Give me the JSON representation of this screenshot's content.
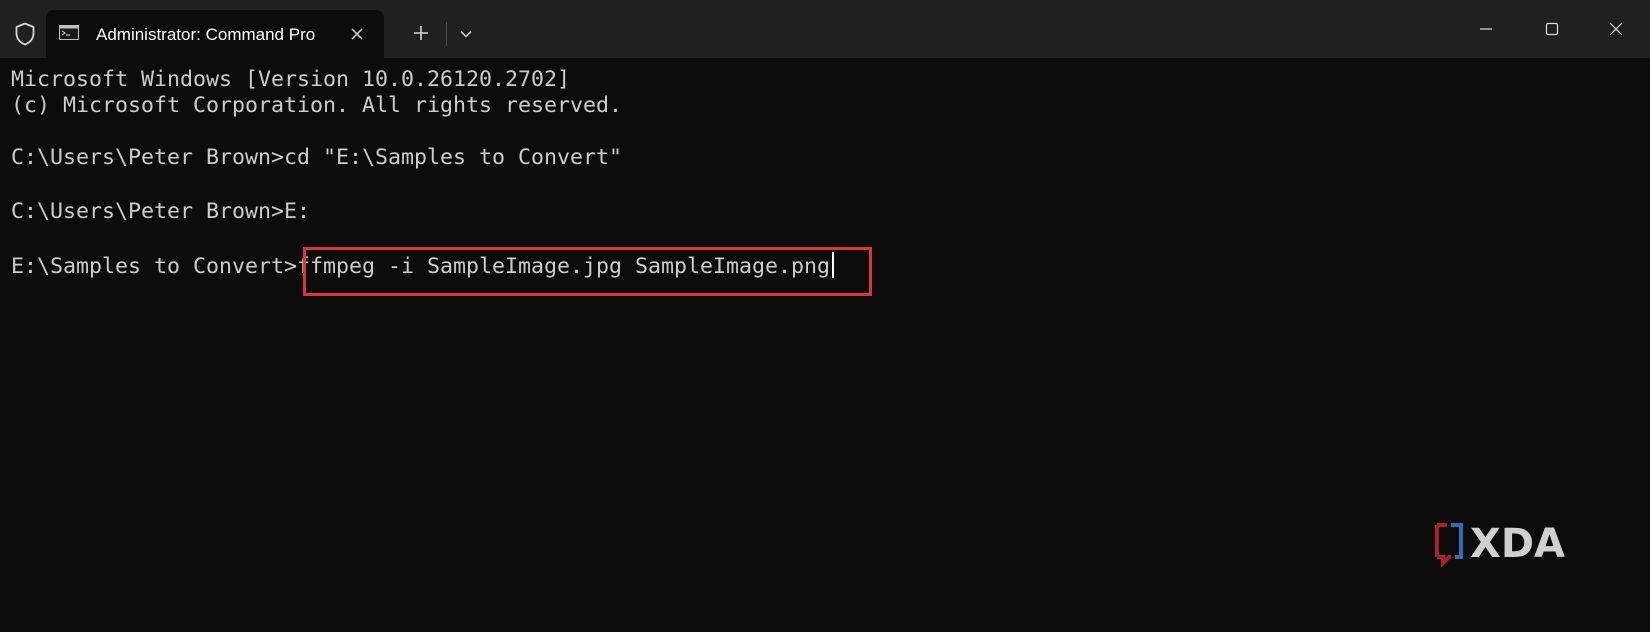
{
  "window": {
    "tab_title": "Administrator: Command Pro",
    "icons": {
      "shield": "shield-icon",
      "console": "console-icon",
      "close_tab": "close-icon",
      "new_tab": "plus-icon",
      "dropdown": "chevron-down-icon",
      "minimize": "minimize-icon",
      "maximize": "maximize-icon",
      "close_window": "close-icon"
    }
  },
  "terminal": {
    "line1": "Microsoft Windows [Version 10.0.26120.2702]",
    "line2": "(c) Microsoft Corporation. All rights reserved.",
    "line3": "C:\\Users\\Peter Brown>cd \"E:\\Samples to Convert\"",
    "line4": "C:\\Users\\Peter Brown>E:",
    "prompt": "E:\\Samples to Convert>",
    "command": "ffmpeg -i SampleImage.jpg SampleImage.png"
  },
  "watermark": {
    "text": "XDA"
  },
  "colors": {
    "background": "#0c0c0c",
    "titlebar": "#202020",
    "text": "#cccccc",
    "highlight": "#e0323a"
  }
}
